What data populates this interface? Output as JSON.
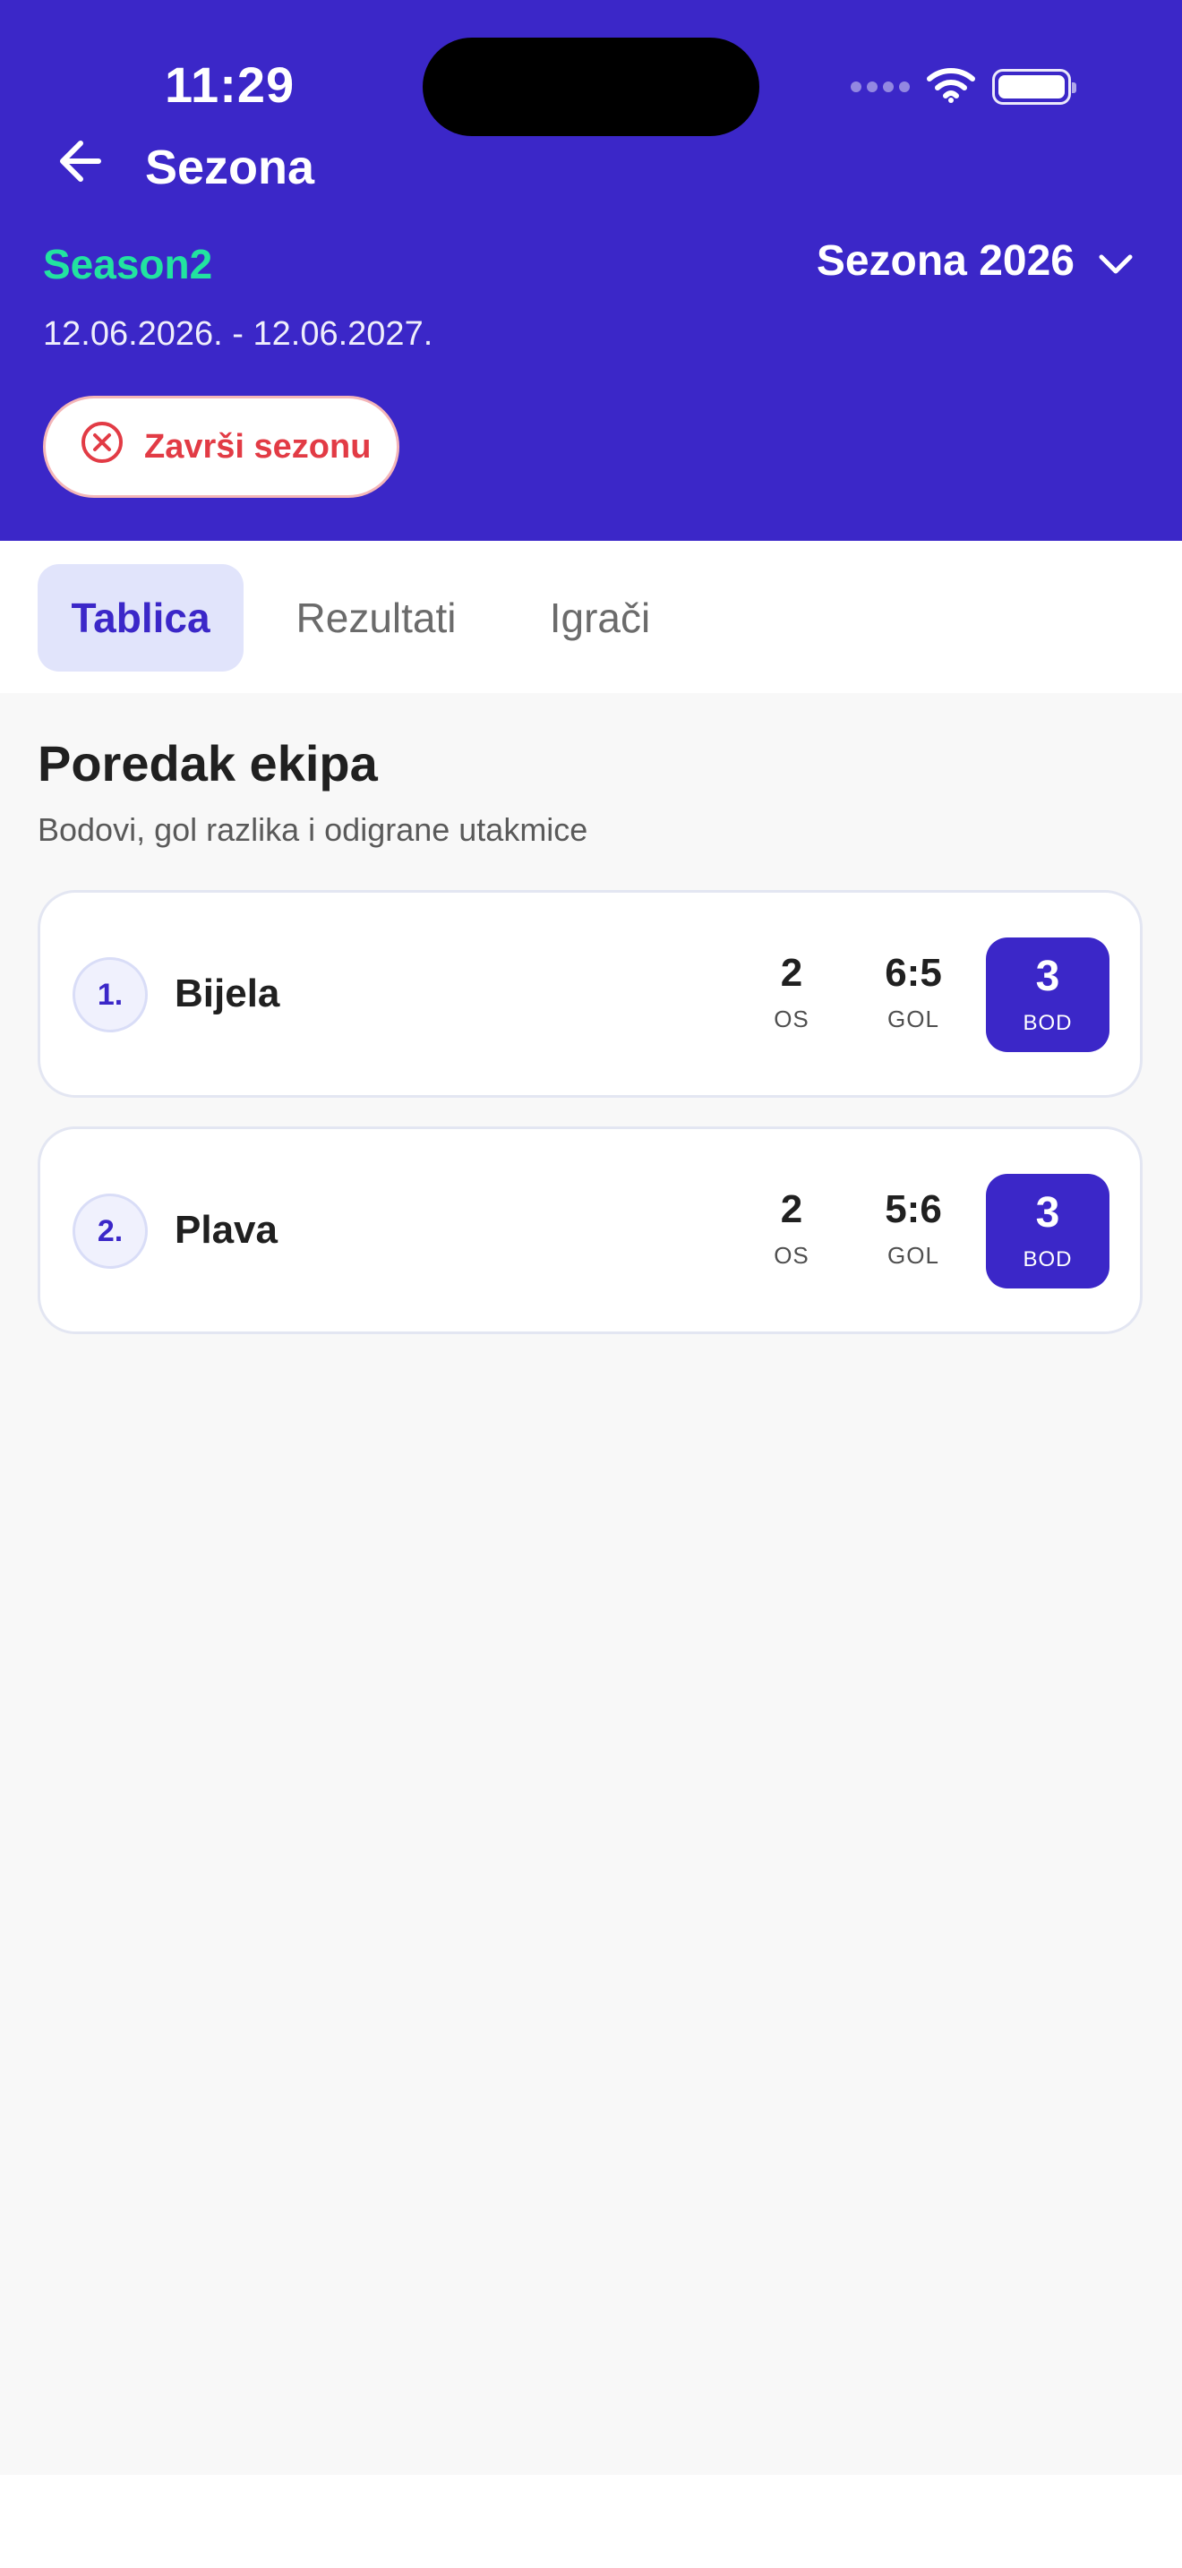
{
  "status_bar": {
    "time": "11:29"
  },
  "header": {
    "title": "Sezona",
    "season_name": "Season2",
    "season_select_label": "Sezona 2026",
    "season_dates": "12.06.2026. - 12.06.2027.",
    "end_season_label": "Završi sezonu"
  },
  "tabs": [
    {
      "label": "Tablica",
      "active": true
    },
    {
      "label": "Rezultati",
      "active": false
    },
    {
      "label": "Igrači",
      "active": false
    }
  ],
  "standings": {
    "title": "Poredak ekipa",
    "subtitle": "Bodovi, gol razlika i odigrane utakmice",
    "labels": {
      "played": "OS",
      "goals": "GOL",
      "points": "BOD"
    },
    "rows": [
      {
        "rank": "1.",
        "team": "Bijela",
        "played": "2",
        "goals": "6:5",
        "points": "3"
      },
      {
        "rank": "2.",
        "team": "Plava",
        "played": "2",
        "goals": "5:6",
        "points": "3"
      }
    ]
  },
  "colors": {
    "primary": "#3b27c8",
    "season_accent": "#22e3a0",
    "danger": "#e23b45"
  },
  "icons": {
    "back": "arrow-left-icon",
    "dropdown": "chevron-down-icon",
    "end_season": "close-circle-icon",
    "wifi": "wifi-icon",
    "battery": "battery-icon",
    "signal": "signal-icon"
  }
}
